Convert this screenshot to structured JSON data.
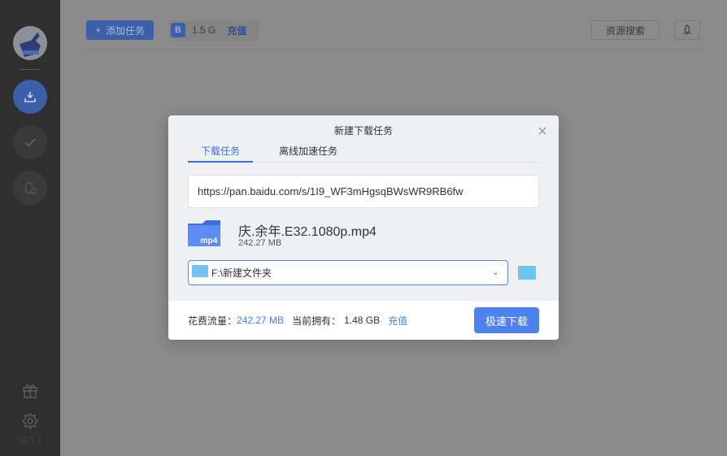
{
  "sidebar": {
    "version": "v2.5.1"
  },
  "toolbar": {
    "add_task": "添加任务",
    "quota": "1.5 G",
    "recharge": "充值",
    "resource_search": "资源搜索"
  },
  "modal": {
    "title": "新建下载任务",
    "tabs": [
      {
        "label": "下载任务"
      },
      {
        "label": "离线加速任务"
      }
    ],
    "url": "https://pan.baidu.com/s/1I9_WF3mHgsqBWsWR9RB6fw",
    "file": {
      "name": "庆.余年.E32.1080p.mp4",
      "size": "242.27 MB",
      "ext": "mp4"
    },
    "save_path": "F:\\新建文件夹",
    "footer": {
      "cost_label": "花费流量：",
      "cost": "242.27 MB",
      "own_label": "当前拥有：",
      "own": "1.48 GB",
      "recharge": "充值",
      "download": "极速下载"
    }
  }
}
